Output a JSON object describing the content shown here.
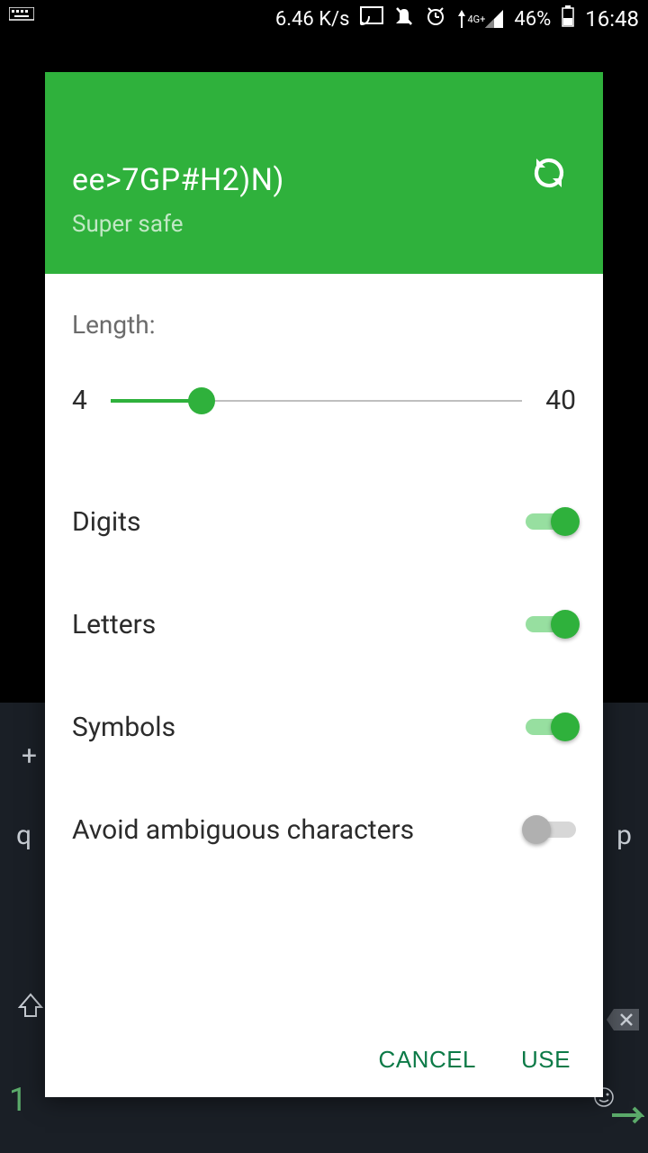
{
  "status": {
    "speed": "6.46 K/s",
    "data_label": "4G+",
    "battery": "46%",
    "time": "16:48"
  },
  "header": {
    "password": "ee>7GP#H2)N)",
    "strength": "Super safe"
  },
  "length": {
    "label": "Length:",
    "min": "4",
    "max": "40",
    "value_percent": 22
  },
  "options": {
    "digits": {
      "label": "Digits",
      "enabled": true
    },
    "letters": {
      "label": "Letters",
      "enabled": true
    },
    "symbols": {
      "label": "Symbols",
      "enabled": true
    },
    "ambiguous": {
      "label": "Avoid ambiguous characters",
      "enabled": false
    }
  },
  "actions": {
    "cancel": "CANCEL",
    "use": "USE"
  },
  "kb": {
    "plus": "+",
    "q": "q",
    "p": "p",
    "one": "1"
  }
}
